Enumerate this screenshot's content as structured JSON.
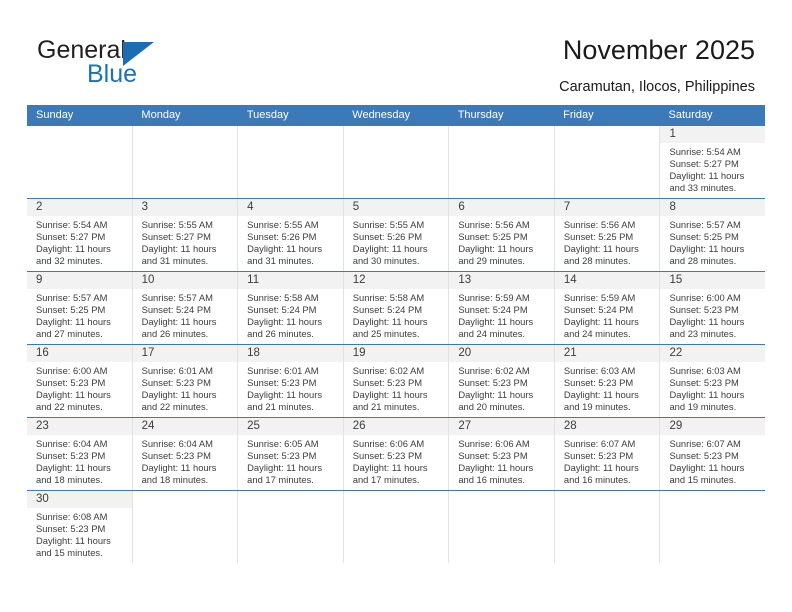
{
  "brand": {
    "name_part1": "General",
    "name_part2": "Blue",
    "accent_color": "#1b6cb0",
    "triangle_icon": "triangle-icon"
  },
  "header": {
    "title": "November 2025",
    "subtitle": "Caramutan, Ilocos, Philippines"
  },
  "calendar": {
    "header_bg": "#3b79b8",
    "daynum_bg": "#f2f2f2",
    "weekdays": [
      "Sunday",
      "Monday",
      "Tuesday",
      "Wednesday",
      "Thursday",
      "Friday",
      "Saturday"
    ],
    "weeks": [
      [
        {
          "day": "",
          "blank": true
        },
        {
          "day": "",
          "blank": true
        },
        {
          "day": "",
          "blank": true
        },
        {
          "day": "",
          "blank": true
        },
        {
          "day": "",
          "blank": true
        },
        {
          "day": "",
          "blank": true
        },
        {
          "day": "1",
          "sunrise": "Sunrise: 5:54 AM",
          "sunset": "Sunset: 5:27 PM",
          "daylight1": "Daylight: 11 hours",
          "daylight2": "and 33 minutes."
        }
      ],
      [
        {
          "day": "2",
          "sunrise": "Sunrise: 5:54 AM",
          "sunset": "Sunset: 5:27 PM",
          "daylight1": "Daylight: 11 hours",
          "daylight2": "and 32 minutes."
        },
        {
          "day": "3",
          "sunrise": "Sunrise: 5:55 AM",
          "sunset": "Sunset: 5:27 PM",
          "daylight1": "Daylight: 11 hours",
          "daylight2": "and 31 minutes."
        },
        {
          "day": "4",
          "sunrise": "Sunrise: 5:55 AM",
          "sunset": "Sunset: 5:26 PM",
          "daylight1": "Daylight: 11 hours",
          "daylight2": "and 31 minutes."
        },
        {
          "day": "5",
          "sunrise": "Sunrise: 5:55 AM",
          "sunset": "Sunset: 5:26 PM",
          "daylight1": "Daylight: 11 hours",
          "daylight2": "and 30 minutes."
        },
        {
          "day": "6",
          "sunrise": "Sunrise: 5:56 AM",
          "sunset": "Sunset: 5:25 PM",
          "daylight1": "Daylight: 11 hours",
          "daylight2": "and 29 minutes."
        },
        {
          "day": "7",
          "sunrise": "Sunrise: 5:56 AM",
          "sunset": "Sunset: 5:25 PM",
          "daylight1": "Daylight: 11 hours",
          "daylight2": "and 28 minutes."
        },
        {
          "day": "8",
          "sunrise": "Sunrise: 5:57 AM",
          "sunset": "Sunset: 5:25 PM",
          "daylight1": "Daylight: 11 hours",
          "daylight2": "and 28 minutes."
        }
      ],
      [
        {
          "day": "9",
          "sunrise": "Sunrise: 5:57 AM",
          "sunset": "Sunset: 5:25 PM",
          "daylight1": "Daylight: 11 hours",
          "daylight2": "and 27 minutes."
        },
        {
          "day": "10",
          "sunrise": "Sunrise: 5:57 AM",
          "sunset": "Sunset: 5:24 PM",
          "daylight1": "Daylight: 11 hours",
          "daylight2": "and 26 minutes."
        },
        {
          "day": "11",
          "sunrise": "Sunrise: 5:58 AM",
          "sunset": "Sunset: 5:24 PM",
          "daylight1": "Daylight: 11 hours",
          "daylight2": "and 26 minutes."
        },
        {
          "day": "12",
          "sunrise": "Sunrise: 5:58 AM",
          "sunset": "Sunset: 5:24 PM",
          "daylight1": "Daylight: 11 hours",
          "daylight2": "and 25 minutes."
        },
        {
          "day": "13",
          "sunrise": "Sunrise: 5:59 AM",
          "sunset": "Sunset: 5:24 PM",
          "daylight1": "Daylight: 11 hours",
          "daylight2": "and 24 minutes."
        },
        {
          "day": "14",
          "sunrise": "Sunrise: 5:59 AM",
          "sunset": "Sunset: 5:24 PM",
          "daylight1": "Daylight: 11 hours",
          "daylight2": "and 24 minutes."
        },
        {
          "day": "15",
          "sunrise": "Sunrise: 6:00 AM",
          "sunset": "Sunset: 5:23 PM",
          "daylight1": "Daylight: 11 hours",
          "daylight2": "and 23 minutes."
        }
      ],
      [
        {
          "day": "16",
          "sunrise": "Sunrise: 6:00 AM",
          "sunset": "Sunset: 5:23 PM",
          "daylight1": "Daylight: 11 hours",
          "daylight2": "and 22 minutes."
        },
        {
          "day": "17",
          "sunrise": "Sunrise: 6:01 AM",
          "sunset": "Sunset: 5:23 PM",
          "daylight1": "Daylight: 11 hours",
          "daylight2": "and 22 minutes."
        },
        {
          "day": "18",
          "sunrise": "Sunrise: 6:01 AM",
          "sunset": "Sunset: 5:23 PM",
          "daylight1": "Daylight: 11 hours",
          "daylight2": "and 21 minutes."
        },
        {
          "day": "19",
          "sunrise": "Sunrise: 6:02 AM",
          "sunset": "Sunset: 5:23 PM",
          "daylight1": "Daylight: 11 hours",
          "daylight2": "and 21 minutes."
        },
        {
          "day": "20",
          "sunrise": "Sunrise: 6:02 AM",
          "sunset": "Sunset: 5:23 PM",
          "daylight1": "Daylight: 11 hours",
          "daylight2": "and 20 minutes."
        },
        {
          "day": "21",
          "sunrise": "Sunrise: 6:03 AM",
          "sunset": "Sunset: 5:23 PM",
          "daylight1": "Daylight: 11 hours",
          "daylight2": "and 19 minutes."
        },
        {
          "day": "22",
          "sunrise": "Sunrise: 6:03 AM",
          "sunset": "Sunset: 5:23 PM",
          "daylight1": "Daylight: 11 hours",
          "daylight2": "and 19 minutes."
        }
      ],
      [
        {
          "day": "23",
          "sunrise": "Sunrise: 6:04 AM",
          "sunset": "Sunset: 5:23 PM",
          "daylight1": "Daylight: 11 hours",
          "daylight2": "and 18 minutes."
        },
        {
          "day": "24",
          "sunrise": "Sunrise: 6:04 AM",
          "sunset": "Sunset: 5:23 PM",
          "daylight1": "Daylight: 11 hours",
          "daylight2": "and 18 minutes."
        },
        {
          "day": "25",
          "sunrise": "Sunrise: 6:05 AM",
          "sunset": "Sunset: 5:23 PM",
          "daylight1": "Daylight: 11 hours",
          "daylight2": "and 17 minutes."
        },
        {
          "day": "26",
          "sunrise": "Sunrise: 6:06 AM",
          "sunset": "Sunset: 5:23 PM",
          "daylight1": "Daylight: 11 hours",
          "daylight2": "and 17 minutes."
        },
        {
          "day": "27",
          "sunrise": "Sunrise: 6:06 AM",
          "sunset": "Sunset: 5:23 PM",
          "daylight1": "Daylight: 11 hours",
          "daylight2": "and 16 minutes."
        },
        {
          "day": "28",
          "sunrise": "Sunrise: 6:07 AM",
          "sunset": "Sunset: 5:23 PM",
          "daylight1": "Daylight: 11 hours",
          "daylight2": "and 16 minutes."
        },
        {
          "day": "29",
          "sunrise": "Sunrise: 6:07 AM",
          "sunset": "Sunset: 5:23 PM",
          "daylight1": "Daylight: 11 hours",
          "daylight2": "and 15 minutes."
        }
      ],
      [
        {
          "day": "30",
          "sunrise": "Sunrise: 6:08 AM",
          "sunset": "Sunset: 5:23 PM",
          "daylight1": "Daylight: 11 hours",
          "daylight2": "and 15 minutes."
        },
        {
          "day": "",
          "blank": true
        },
        {
          "day": "",
          "blank": true
        },
        {
          "day": "",
          "blank": true
        },
        {
          "day": "",
          "blank": true
        },
        {
          "day": "",
          "blank": true
        },
        {
          "day": "",
          "blank": true
        }
      ]
    ]
  }
}
